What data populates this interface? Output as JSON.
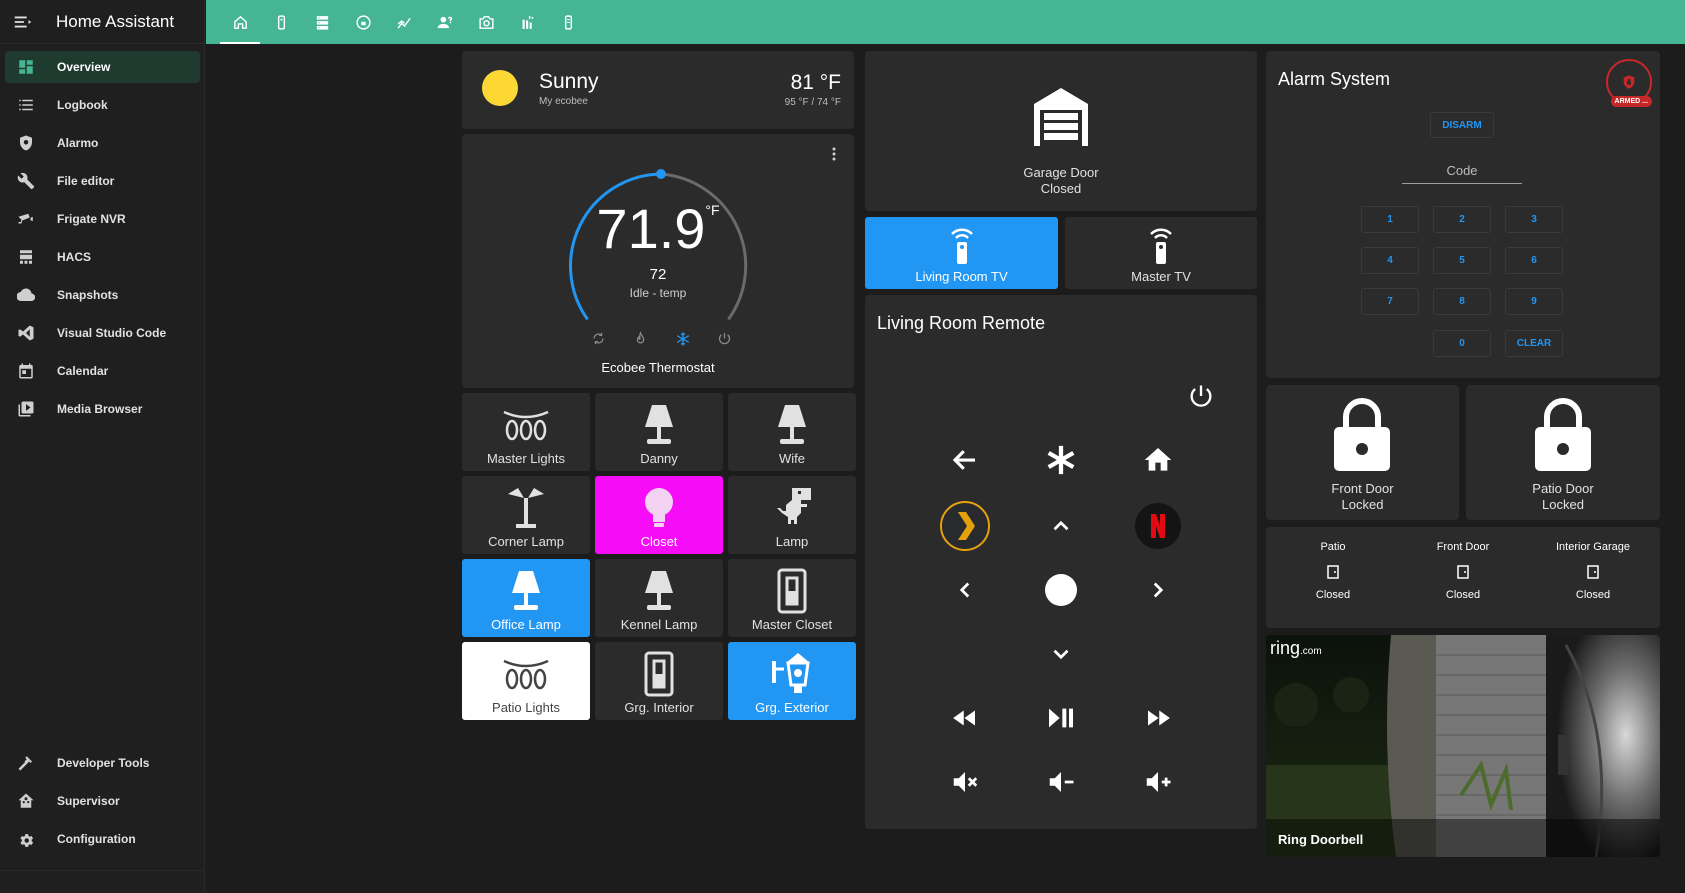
{
  "app": {
    "title": "Home Assistant"
  },
  "sidebar": {
    "items": [
      {
        "label": "Overview",
        "icon": "dashboard-icon"
      },
      {
        "label": "Logbook",
        "icon": "logbook-icon"
      },
      {
        "label": "Alarmo",
        "icon": "shield-icon"
      },
      {
        "label": "File editor",
        "icon": "wrench-icon"
      },
      {
        "label": "Frigate NVR",
        "icon": "cctv-icon"
      },
      {
        "label": "HACS",
        "icon": "hacs-icon"
      },
      {
        "label": "Snapshots",
        "icon": "cloud-icon"
      },
      {
        "label": "Visual Studio Code",
        "icon": "vscode-icon"
      },
      {
        "label": "Calendar",
        "icon": "calendar-icon"
      },
      {
        "label": "Media Browser",
        "icon": "play-box-icon"
      }
    ],
    "bottom_items": [
      {
        "label": "Developer Tools",
        "icon": "hammer-icon"
      },
      {
        "label": "Supervisor",
        "icon": "home-assistant-icon"
      },
      {
        "label": "Configuration",
        "icon": "cog-icon"
      }
    ]
  },
  "topbar": {
    "tabs": [
      "home-icon",
      "remote-icon",
      "server-icon",
      "lock-outline-icon",
      "chart-icon",
      "account-question-icon",
      "camera-icon",
      "sensor-icon",
      "remote-small-icon"
    ]
  },
  "weather": {
    "condition": "Sunny",
    "location": "My ecobee",
    "temperature": "81 °F",
    "hilo": "95 °F / 74 °F"
  },
  "thermostat": {
    "current": "71.9",
    "unit": "°F",
    "target": "72",
    "state": "Idle - temp",
    "name": "Ecobee Thermostat",
    "modes": [
      "heat-cool-icon",
      "fire-icon",
      "snowflake-icon",
      "power-icon"
    ],
    "active_mode": "snowflake-icon"
  },
  "garage": {
    "name": "Garage Door",
    "state": "Closed"
  },
  "tv": {
    "living": "Living Room TV",
    "master": "Master TV"
  },
  "remote": {
    "title": "Living Room Remote"
  },
  "buttons": [
    {
      "label": "Master Lights",
      "icon": "string-lights-icon"
    },
    {
      "label": "Danny",
      "icon": "lamp-icon"
    },
    {
      "label": "Wife",
      "icon": "lamp-icon"
    },
    {
      "label": "Corner Lamp",
      "icon": "floor-lamp-icon"
    },
    {
      "label": "Closet",
      "icon": "lightbulb-icon"
    },
    {
      "label": "Lamp",
      "icon": "dinosaur-icon"
    },
    {
      "label": "Office Lamp",
      "icon": "lamp-icon"
    },
    {
      "label": "Kennel Lamp",
      "icon": "lamp-icon"
    },
    {
      "label": "Master Closet",
      "icon": "light-switch-icon"
    },
    {
      "label": "Patio Lights",
      "icon": "string-lights-icon"
    },
    {
      "label": "Grg. Interior",
      "icon": "light-switch-icon"
    },
    {
      "label": "Grg. Exterior",
      "icon": "outdoor-lamp-icon"
    }
  ],
  "alarm": {
    "title": "Alarm System",
    "badge": "ARMED ...",
    "disarm": "DISARM",
    "code_label": "Code",
    "keys": [
      "1",
      "2",
      "3",
      "4",
      "5",
      "6",
      "7",
      "8",
      "9",
      "0",
      "CLEAR"
    ]
  },
  "locks": [
    {
      "name": "Front Door",
      "state": "Locked"
    },
    {
      "name": "Patio Door",
      "state": "Locked"
    }
  ],
  "doors": [
    {
      "name": "Patio",
      "state": "Closed"
    },
    {
      "name": "Front Door",
      "state": "Closed"
    },
    {
      "name": "Interior Garage",
      "state": "Closed"
    }
  ],
  "camera": {
    "label": "Ring Doorbell",
    "logo": "ring",
    "logo_suffix": ".com"
  },
  "colors": {
    "accent": "#45b593",
    "blue": "#2196f3",
    "magenta": "#f70cf7",
    "card": "#2b2b2b",
    "background": "#1c1c1c",
    "alarm_red": "#c62828"
  }
}
